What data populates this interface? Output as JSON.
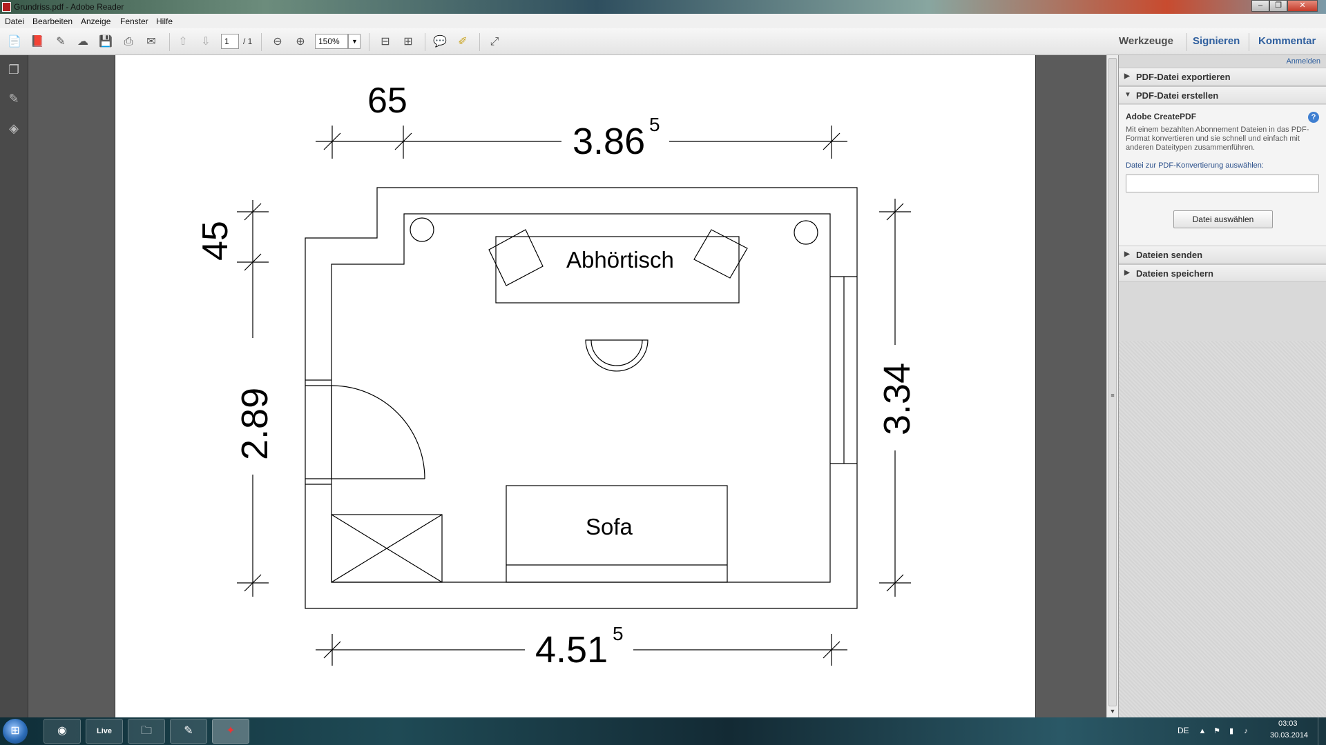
{
  "window": {
    "title": "Grundriss.pdf - Adobe Reader"
  },
  "menu": [
    "Datei",
    "Bearbeiten",
    "Anzeige",
    "Fenster",
    "Hilfe"
  ],
  "toolbar": {
    "page_current": "1",
    "page_total": "/ 1",
    "zoom": "150%",
    "tabs": [
      "Werkzeuge",
      "Signieren",
      "Kommentar"
    ]
  },
  "panel": {
    "signin": "Anmelden",
    "sections": {
      "export": "PDF-Datei exportieren",
      "create": "PDF-Datei erstellen",
      "send": "Dateien senden",
      "save": "Dateien speichern"
    },
    "create": {
      "heading": "Adobe CreatePDF",
      "description": "Mit einem bezahlten Abonnement Dateien in das PDF-Format konvertieren und sie schnell und einfach mit anderen Dateitypen zusammenführen.",
      "field_label": "Datei zur PDF-Konvertierung auswählen:",
      "field_value": "",
      "button": "Datei auswählen"
    }
  },
  "drawing": {
    "dim_top_small": "65",
    "dim_top_main": "3.86",
    "dim_top_main_sup": "5",
    "dim_left_small": "45",
    "dim_left_main": "2.89",
    "dim_right": "3.34",
    "dim_bottom": "4.51",
    "dim_bottom_sup": "5",
    "label_desk": "Abhörtisch",
    "label_sofa": "Sofa"
  },
  "taskbar": {
    "apps": [
      "chrome",
      "live",
      "explorer",
      "notepad",
      "adobe-reader"
    ],
    "live_label": "Live",
    "lang": "DE",
    "time": "03:03",
    "date": "30.03.2014"
  }
}
